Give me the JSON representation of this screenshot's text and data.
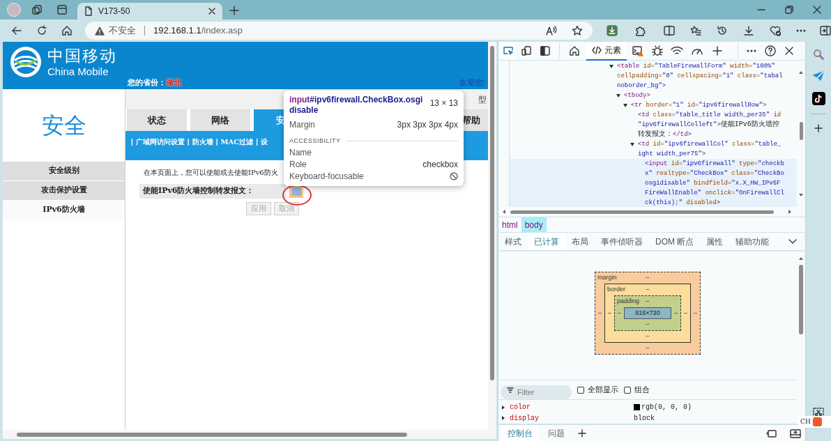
{
  "browser": {
    "tabs": [
      {
        "title": "V173-50",
        "selected": true
      }
    ],
    "address": {
      "security": "不安全",
      "host": "192.168.1.1",
      "path": "/index.asp"
    }
  },
  "router_page": {
    "brand": {
      "name_cn": "中国移动",
      "name_en": "China Mobile"
    },
    "province_label": "您的省份：",
    "province": "湖北",
    "welcome": "欢迎您!",
    "model_label": "型",
    "section_title": "安全",
    "side_menu": [
      {
        "label": "安全级别",
        "selected": false
      },
      {
        "label": "攻击保护设置",
        "selected": false
      },
      {
        "label": "IPv6防火墙",
        "selected": true
      }
    ],
    "main_tabs": [
      {
        "label": "状态",
        "selected": false
      },
      {
        "label": "网络",
        "selected": false
      },
      {
        "label": "安",
        "selected": true
      },
      {
        "label": "帮助",
        "selected": false
      }
    ],
    "sub_tabs": [
      {
        "label": "广域网访问设置"
      },
      {
        "label": "防火墙"
      },
      {
        "label": "MAC过滤"
      },
      {
        "label": "设"
      }
    ],
    "separators": [
      "|",
      "|",
      "|",
      "|"
    ],
    "intro": "在本页面上，您可以使能或去使能IPv6防火",
    "firewall": {
      "label": "使能IPv6防火墙控制转发报文：",
      "checked": false,
      "disabled": true
    },
    "buttons": [
      {
        "label": "应用",
        "disabled": true
      },
      {
        "label": "取消",
        "disabled": true
      }
    ]
  },
  "inspect_tooltip": {
    "selector_tag": "input",
    "selector_rest": "#ipv6firewall.CheckBox.osgidisable",
    "size": "13 × 13",
    "margin_label": "Margin",
    "margin": "3px 3px 3px 4px",
    "section": "ACCESSIBILITY",
    "rows": [
      {
        "kind": "text",
        "label": "Name"
      },
      {
        "kind": "text",
        "label": "Role",
        "value": "checkbox"
      },
      {
        "kind": "icon",
        "label": "Keyboard-focusable"
      }
    ]
  },
  "devtools": {
    "tabs": [
      {
        "label": "元素",
        "selected": true
      }
    ],
    "dom_tree": [
      {
        "expanded": true,
        "selected": false,
        "lines": [
          [
            {
              "kind": "tag",
              "text": "<table"
            },
            {
              "kind": "attr",
              "text": " id="
            },
            {
              "kind": "val",
              "text": "\"TableFirewallForm\""
            },
            {
              "kind": "attr",
              "text": " width="
            },
            {
              "kind": "val",
              "text": "\"100%\""
            }
          ],
          [
            {
              "kind": "attr",
              "text": "cellpadding="
            },
            {
              "kind": "val",
              "text": "\"0\""
            },
            {
              "kind": "attr",
              "text": " cellspacing="
            },
            {
              "kind": "val",
              "text": "\"1\""
            },
            {
              "kind": "attr",
              "text": " class="
            },
            {
              "kind": "val",
              "text": "\"tabal"
            }
          ],
          [
            {
              "kind": "val",
              "text": "noborder_bg\""
            },
            {
              "kind": "tag",
              "text": ">"
            }
          ]
        ],
        "children": [
          {
            "expanded": true,
            "selected": false,
            "lines": [
              [
                {
                  "kind": "tag",
                  "text": "<tbody>"
                }
              ]
            ],
            "children": [
              {
                "expanded": true,
                "selected": false,
                "lines": [
                  [
                    {
                      "kind": "tag",
                      "text": "<tr"
                    },
                    {
                      "kind": "attr",
                      "text": " border="
                    },
                    {
                      "kind": "val",
                      "text": "\"1\""
                    },
                    {
                      "kind": "attr",
                      "text": " id="
                    },
                    {
                      "kind": "val",
                      "text": "\"ipv6firewallRow\""
                    },
                    {
                      "kind": "tag",
                      "text": ">"
                    }
                  ]
                ],
                "children": [
                  {
                    "selected": false,
                    "lines": [
                      [
                        {
                          "kind": "tag",
                          "text": "<td"
                        },
                        {
                          "kind": "attr",
                          "text": " class="
                        },
                        {
                          "kind": "val",
                          "text": "\"table_title width_per35\""
                        },
                        {
                          "kind": "attr",
                          "text": " id"
                        }
                      ],
                      [
                        {
                          "kind": "val",
                          "text": "\"ipv6firewallColleft\""
                        },
                        {
                          "kind": "tag",
                          "text": ">"
                        },
                        {
                          "kind": "text",
                          "text": "使能IPv6防火墙控"
                        }
                      ],
                      [
                        {
                          "kind": "text",
                          "text": "转发报文："
                        },
                        {
                          "kind": "tag",
                          "text": "</td>"
                        }
                      ]
                    ]
                  },
                  {
                    "expanded": true,
                    "selected": false,
                    "lines": [
                      [
                        {
                          "kind": "tag",
                          "text": "<td"
                        },
                        {
                          "kind": "attr",
                          "text": " id="
                        },
                        {
                          "kind": "val",
                          "text": "\"ipv6firewallCol\""
                        },
                        {
                          "kind": "attr",
                          "text": " class="
                        },
                        {
                          "kind": "val",
                          "text": "\"table_"
                        }
                      ],
                      [
                        {
                          "kind": "val",
                          "text": "ight width_per75\""
                        },
                        {
                          "kind": "tag",
                          "text": ">"
                        }
                      ]
                    ],
                    "children": [
                      {
                        "selected": true,
                        "lines": [
                          [
                            {
                              "kind": "tag",
                              "text": "<input"
                            },
                            {
                              "kind": "attr",
                              "text": " id="
                            },
                            {
                              "kind": "val",
                              "text": "\"ipv6firewall\""
                            },
                            {
                              "kind": "attr",
                              "text": " type="
                            },
                            {
                              "kind": "val",
                              "text": "\"checkb"
                            }
                          ],
                          [
                            {
                              "kind": "val",
                              "text": "x\""
                            },
                            {
                              "kind": "attr",
                              "text": " realtype="
                            },
                            {
                              "kind": "val",
                              "text": "\"CheckBox\""
                            },
                            {
                              "kind": "attr",
                              "text": " class="
                            },
                            {
                              "kind": "val",
                              "text": "\"CheckBo"
                            }
                          ],
                          [
                            {
                              "kind": "val",
                              "text": "osgidisable\""
                            },
                            {
                              "kind": "attr",
                              "text": " bindfield="
                            },
                            {
                              "kind": "val",
                              "text": "\"x.X_HW_IPv6F"
                            }
                          ],
                          [
                            {
                              "kind": "val",
                              "text": "FireWallEnable\""
                            },
                            {
                              "kind": "attr",
                              "text": " onclick="
                            },
                            {
                              "kind": "val",
                              "text": "\"OnFirewallCl"
                            }
                          ],
                          [
                            {
                              "kind": "val",
                              "text": "ck(this);\""
                            },
                            {
                              "kind": "attr",
                              "text": " disabled"
                            },
                            {
                              "kind": "tag",
                              "text": ">"
                            }
                          ]
                        ]
                      }
                    ]
                  }
                ]
              }
            ]
          }
        ]
      }
    ],
    "breadcrumb": [
      {
        "label": "html",
        "selected": false
      },
      {
        "label": "body",
        "selected": true
      }
    ],
    "panel_tabs": [
      {
        "label": "样式",
        "selected": false
      },
      {
        "label": "已计算",
        "selected": true
      },
      {
        "label": "布局",
        "selected": false
      },
      {
        "label": "事件侦听器",
        "selected": false
      },
      {
        "label": "DOM 断点",
        "selected": false
      },
      {
        "label": "属性",
        "selected": false
      },
      {
        "label": "辅助功能",
        "selected": false
      }
    ],
    "box_model": {
      "margin": {
        "label": "margin",
        "top": "–",
        "right": "–",
        "bottom": "–",
        "left": "–"
      },
      "border": {
        "label": "border",
        "top": "–",
        "right": "–",
        "bottom": "–",
        "left": "–"
      },
      "padding": {
        "label": "padding",
        "top": "–",
        "right": "–",
        "bottom": "–",
        "left": "–"
      },
      "content": "816×730"
    },
    "filter": {
      "placeholder": "Filter"
    },
    "options": [
      {
        "label": "全部显示",
        "checked": false
      },
      {
        "label": "组合",
        "checked": false
      }
    ],
    "properties": [
      {
        "name": "color",
        "value": "rgb(0, 0, 0)",
        "color": "#000000"
      },
      {
        "name": "display",
        "value": "block"
      }
    ],
    "drawer_tabs": [
      {
        "label": "控制台",
        "selected": true
      },
      {
        "label": "问题",
        "selected": false
      }
    ]
  },
  "ime": {
    "label": "CH"
  }
}
